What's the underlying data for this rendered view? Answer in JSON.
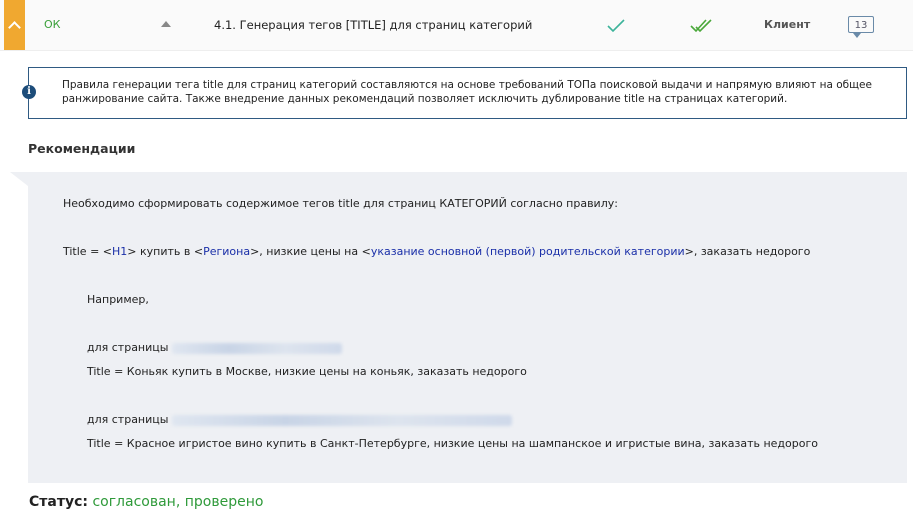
{
  "header": {
    "status": "ОК",
    "title": "4.1. Генерация тегов [TITLE] для страниц категорий",
    "owner": "Клиент",
    "comment_count": "13"
  },
  "info": {
    "text": "Правила генерации тега title для страниц категорий составляются на основе требований ТОПа поисковой выдачи и напрямую влияют на общее ранжирование сайта. Также внедрение данных рекомендаций позволяет исключить дублирование title на страницах категорий."
  },
  "recommendations": {
    "heading": "Рекомендации",
    "intro": "Необходимо сформировать содержимое тегов title для страниц КАТЕГОРИЙ согласно правилу:",
    "rule": {
      "prefix": "Title = <",
      "h1": "H1",
      "mid1": "> купить в <",
      "region": "Региона",
      "mid2": ">, низкие цены на <",
      "parent": "указание основной (первой) родительской категории",
      "suffix": ">, заказать недорого"
    },
    "example_label": "Например,",
    "examples": [
      {
        "page_label": "для страницы",
        "title": "Title = Коньяк купить в Москве, низкие цены на коньяк, заказать недорого"
      },
      {
        "page_label": "для страницы",
        "title": "Title = Красное игристое вино купить в Санкт-Петербурге, низкие цены на шампанское и игристые вина, заказать недорого"
      }
    ]
  },
  "status": {
    "label": "Статус:",
    "value": "согласован, проверено"
  },
  "colors": {
    "accent_orange": "#f0a830",
    "ok_green": "#3aa03a",
    "info_border": "#2f5a82",
    "link_blue": "#1a2fa8",
    "panel_bg": "#eef0f4"
  }
}
